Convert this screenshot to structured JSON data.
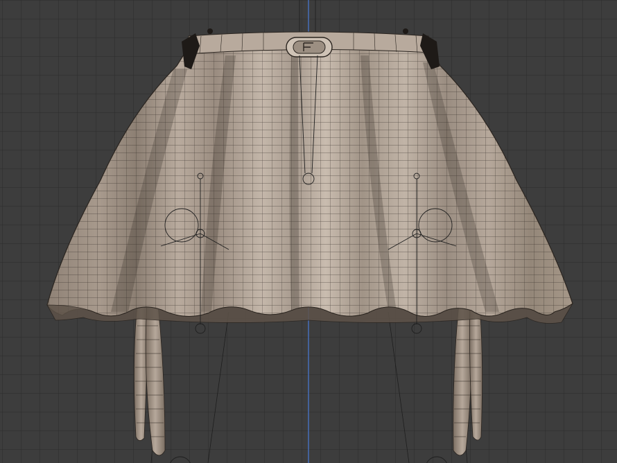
{
  "viewport": {
    "background": "#3d3d3d",
    "grid_color": "#2b2b2b",
    "axis_color": "#4a7ad8"
  },
  "model": {
    "fabric_color": "#b3a598",
    "fabric_shadow": "#6f6357",
    "wire_color": "#2a241f",
    "buckle_color": "#cfc3b6"
  },
  "icons": {
    "object_origin": "origin-circle-icon",
    "bone_empty": "bone-marker-icon"
  }
}
